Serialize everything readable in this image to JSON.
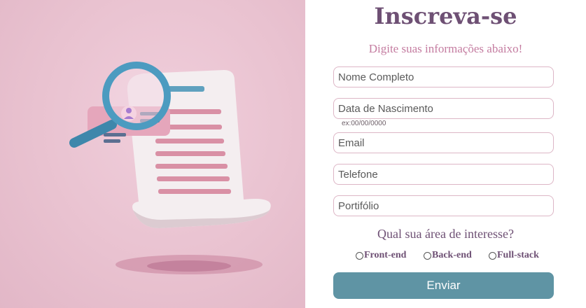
{
  "illustration": {
    "name": "document-search-illustration"
  },
  "form": {
    "title": "Inscreva-se",
    "subtitle": "Digite suas informações abaixo!",
    "fields": {
      "name": {
        "placeholder": "Nome Completo",
        "value": ""
      },
      "birthdate": {
        "placeholder": "Data de Nascimento",
        "value": "",
        "hint": "ex:00/00/0000"
      },
      "email": {
        "placeholder": "Email",
        "value": ""
      },
      "phone": {
        "placeholder": "Telefone",
        "value": ""
      },
      "portfolio": {
        "placeholder": "Portifólio",
        "value": ""
      }
    },
    "interest_question": "Qual sua área de interesse?",
    "interest_options": [
      "Front-end",
      "Back-end",
      "Full-stack"
    ],
    "submit_label": "Enviar"
  },
  "colors": {
    "accent": "#5f94a4",
    "title": "#6e5074",
    "subtitle": "#c47ca0",
    "panel_bg": "#e9c2d0"
  }
}
